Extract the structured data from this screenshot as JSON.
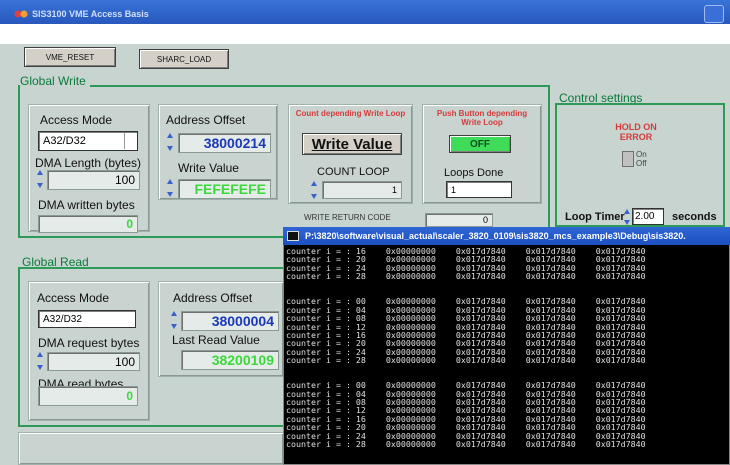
{
  "window": {
    "title": "SIS3100 VME Access Basis"
  },
  "toolbar": {
    "vme_reset": "VME_RESET",
    "sharc_load": "SHARC_LOAD"
  },
  "global_write": {
    "title": "Global  Write",
    "access_mode_label": "Access Mode",
    "access_mode_value": "A32/D32",
    "dma_length_label": "DMA Length (bytes)",
    "dma_length_value": "100",
    "dma_written_label": "DMA written bytes",
    "dma_written_value": "0",
    "address_offset_label": "Address Offset",
    "address_offset_value": "38000214",
    "write_value_label": "Write Value",
    "write_value_value": "FEFEFEFE",
    "count_loop_title": "Count depending Write Loop",
    "write_value_button": "Write Value",
    "count_loop_label": "COUNT LOOP",
    "count_loop_value": "1",
    "push_loop_title": "Push Button depending Write Loop",
    "off_button": "OFF",
    "loops_done_label": "Loops Done",
    "loops_done_value": "1",
    "write_return_label": "WRITE RETURN CODE",
    "write_return_value": "0"
  },
  "control_settings": {
    "title": "Control settings",
    "hold_on_error": "HOLD ON ERROR",
    "on_label": "On",
    "off_label": "Off",
    "loop_timer_label": "Loop Timer",
    "loop_timer_value": "2.00",
    "loop_timer_unit": "seconds"
  },
  "global_read": {
    "title": "Global  Read",
    "access_mode_label": "Access Mode",
    "access_mode_value": "A32/D32",
    "dma_request_label": "DMA request bytes",
    "dma_request_value": "100",
    "dma_read_label": "DMA read bytes",
    "dma_read_value": "0",
    "address_offset_label": "Address Offset",
    "address_offset_value": "38000004",
    "last_read_label": "Last Read Value",
    "last_read_value": "38200109"
  },
  "console": {
    "title": "P:\\3820\\software\\visual_actual\\scaler_3820_0109\\sis3820_mcs_example3\\Debug\\sis3820.",
    "blocks": [
      [
        "counter i = : 16    0x00000000    0x017d7840    0x017d7840    0x017d7840",
        "counter i = : 20    0x00000000    0x017d7840    0x017d7840    0x017d7840",
        "counter i = : 24    0x00000000    0x017d7840    0x017d7840    0x017d7840",
        "counter i = : 28    0x00000000    0x017d7840    0x017d7840    0x017d7840"
      ],
      [
        "counter i = : 00    0x00000000    0x017d7840    0x017d7840    0x017d7840",
        "counter i = : 04    0x00000000    0x017d7840    0x017d7840    0x017d7840",
        "counter i = : 08    0x00000000    0x017d7840    0x017d7840    0x017d7840",
        "counter i = : 12    0x00000000    0x017d7840    0x017d7840    0x017d7840",
        "counter i = : 16    0x00000000    0x017d7840    0x017d7840    0x017d7840",
        "counter i = : 20    0x00000000    0x017d7840    0x017d7840    0x017d7840",
        "counter i = : 24    0x00000000    0x017d7840    0x017d7840    0x017d7840",
        "counter i = : 28    0x00000000    0x017d7840    0x017d7840    0x017d7840"
      ],
      [
        "counter i = : 00    0x00000000    0x017d7840    0x017d7840    0x017d7840",
        "counter i = : 04    0x00000000    0x017d7840    0x017d7840    0x017d7840",
        "counter i = : 08    0x00000000    0x017d7840    0x017d7840    0x017d7840",
        "counter i = : 12    0x00000000    0x017d7840    0x017d7840    0x017d7840",
        "counter i = : 16    0x00000000    0x017d7840    0x017d7840    0x017d7840",
        "counter i = : 20    0x00000000    0x017d7840    0x017d7840    0x017d7840",
        "counter i = : 24    0x00000000    0x017d7840    0x017d7840    0x017d7840",
        "counter i = : 28    0x00000000    0x017d7840    0x017d7840    0x017d7840"
      ]
    ]
  },
  "colors": {
    "frame_green": "#2e9a58",
    "value_blue": "#1b39b8",
    "value_green": "#3bd83b",
    "alert_red": "#d43c3c"
  }
}
